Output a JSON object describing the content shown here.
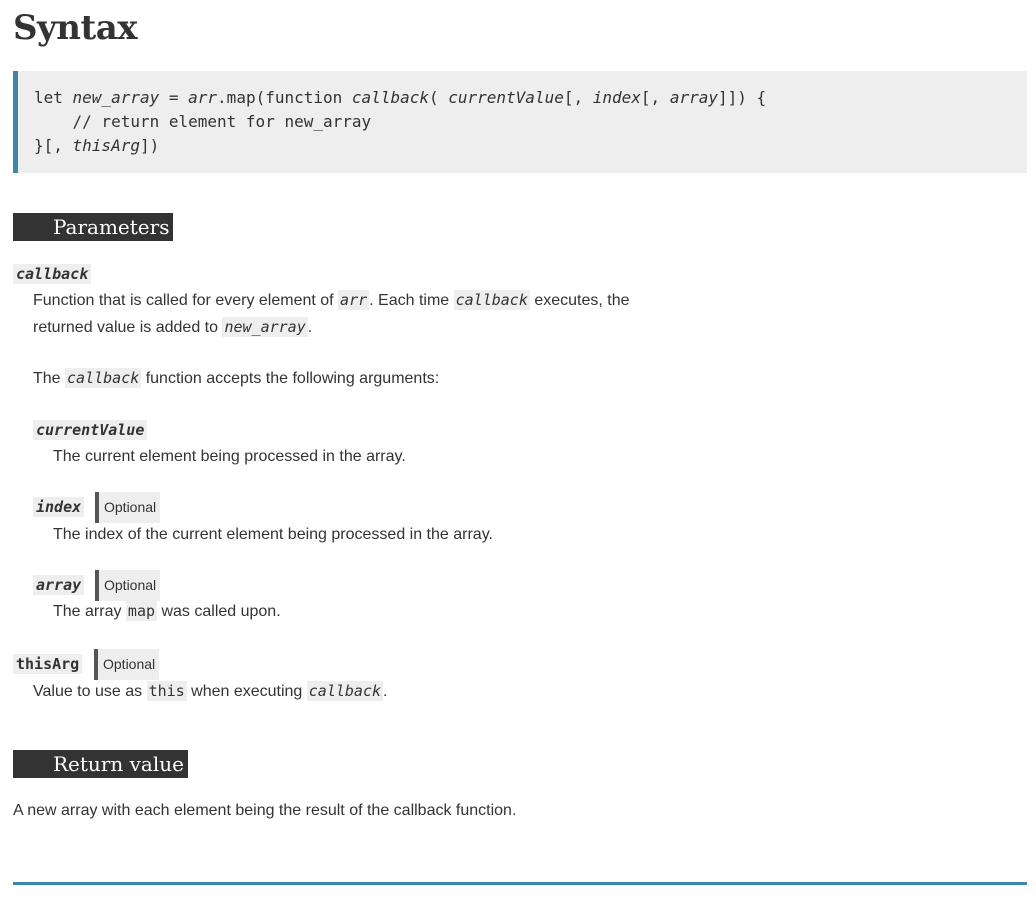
{
  "title": "Syntax",
  "code": {
    "line1": [
      "let ",
      "new_array",
      " = ",
      "arr",
      ".map(function ",
      "callback",
      "( ",
      "currentValue",
      "[, ",
      "index",
      "[, ",
      "array",
      "]]) {"
    ],
    "line2": "    // return element for new_array",
    "line3": [
      "}[, ",
      "thisArg",
      "])"
    ]
  },
  "parameters": {
    "heading": "Parameters",
    "callback": {
      "term": "callback",
      "desc_a1": "Function that is called for every element of ",
      "desc_code1": "arr",
      "desc_a2": ". Each time ",
      "desc_code2": "callback",
      "desc_a3": " executes, the",
      "desc_b1": "returned value is added to ",
      "desc_code3": "new_array",
      "desc_b2": ".",
      "args_1": "The ",
      "args_code": "callback",
      "args_2": " function accepts the following arguments:"
    },
    "currentValue": {
      "term": "currentValue",
      "desc": "The current element being processed in the array."
    },
    "index": {
      "term": "index",
      "badge": "Optional",
      "desc": "The index of the current element being processed in the array."
    },
    "array": {
      "term": "array",
      "badge": "Optional",
      "desc_1": "The array ",
      "desc_code": "map",
      "desc_2": " was called upon."
    },
    "thisArg": {
      "term": "thisArg",
      "badge": "Optional",
      "desc_1": "Value to use as ",
      "desc_code1": "this",
      "desc_2": " when executing ",
      "desc_code2": "callback",
      "desc_3": "."
    }
  },
  "return_value": {
    "heading": "Return value",
    "desc": "A new array with each element being the result of the callback function."
  },
  "colors": {
    "accent": "#3f87a6",
    "heading_bg": "#333333",
    "code_bg": "#eeeeee"
  }
}
